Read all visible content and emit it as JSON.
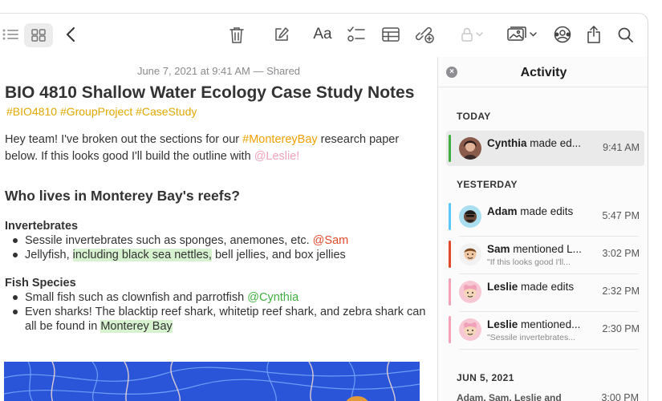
{
  "toolbar": {
    "tools": [
      "list-view",
      "gallery-view",
      "back",
      "delete",
      "compose",
      "format",
      "checklist",
      "table",
      "collaborate",
      "lock",
      "media",
      "share-collaborators",
      "share",
      "search"
    ],
    "format_label": "Aa"
  },
  "note": {
    "date": "June 7, 2021 at 9:41 AM — Shared",
    "title": "BIO 4810 Shallow Water Ecology Case Study Notes",
    "tags": "#BIO4810 #GroupProject #CaseStudy",
    "intro": {
      "text1": "Hey team! I've broken out the sections for our ",
      "tag": "#MontereyBay",
      "text2": " research paper below. If this looks good I'll build the outline with ",
      "mention": "@Leslie!"
    },
    "heading": "Who lives in Monterey Bay's reefs?",
    "invertebrates": {
      "heading": "Invertebrates",
      "item1": {
        "text": "Sessile invertebrates such as sponges, anemones, etc. ",
        "mention": "@Sam"
      },
      "item2": {
        "text1": "Jellyfish, ",
        "highlight": "including black sea nettles,",
        "text2": " bell jellies, and box jellies"
      }
    },
    "fish": {
      "heading": "Fish Species",
      "item1": {
        "text": "Small fish such as clownfish and parrotfish ",
        "mention": "@Cynthia"
      },
      "item2": {
        "text": "Even sharks! The blacktip reef shark, whitetip reef shark, and zebra shark can all be found in ",
        "highlight": "Monterey Bay"
      }
    }
  },
  "activity": {
    "title": "Activity",
    "sections": {
      "today": "TODAY",
      "yesterday": "YESTERDAY",
      "jun5": "JUN 5, 2021"
    },
    "items": [
      {
        "name": "Cynthia",
        "action": " made ed...",
        "time": "9:41 AM",
        "color": "#3fae3f"
      },
      {
        "name": "Adam",
        "action": " made edits",
        "time": "5:47 PM",
        "color": "#5ac8fa"
      },
      {
        "name": "Sam",
        "action": " mentioned L...",
        "sub": "\"If this looks good I'll...",
        "time": "3:02 PM",
        "color": "#e04a2b"
      },
      {
        "name": "Leslie",
        "action": " made edits",
        "time": "2:32 PM",
        "color": "#f4a3b8"
      },
      {
        "name": "Leslie",
        "action": " mentioned...",
        "sub": "\"Sessile invertebrates...",
        "time": "2:30 PM",
        "color": "#f4a3b8"
      }
    ],
    "joined": {
      "text": "Adam, Sam, Leslie and Cynthia joined the note",
      "time": "3:00 PM"
    }
  },
  "colors": {
    "tag": "#e0a800",
    "highlight": "#d6f2cf",
    "mention_red": "#e04a2b",
    "mention_green": "#3fae3f"
  }
}
